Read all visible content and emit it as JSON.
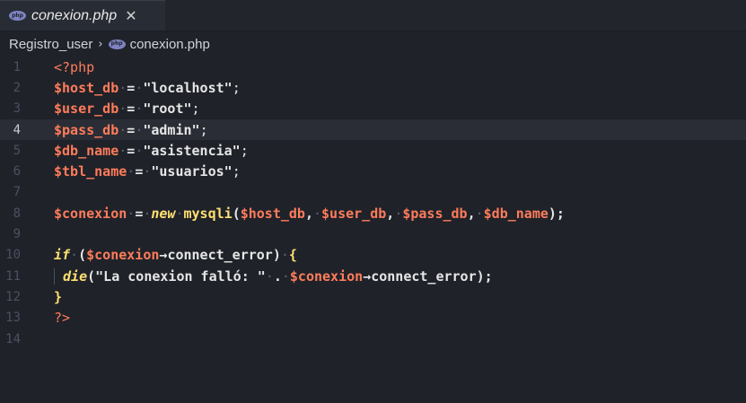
{
  "tab": {
    "icon": "php-icon",
    "icon_label": "php",
    "title": "conexion.php",
    "close_glyph": "✕"
  },
  "breadcrumb": {
    "folder": "Registro_user",
    "separator": "›",
    "file": "conexion.php"
  },
  "active_line": 4,
  "colors": {
    "background": "#1f2229",
    "variable": "#ff7c5b",
    "keyword": "#ffe071",
    "text": "#e6e6e6",
    "line_number": "#4b5161"
  },
  "lines": [
    {
      "n": "1",
      "open_tag": "<?php"
    },
    {
      "n": "2",
      "var": "$host_db",
      "eq": "=",
      "val": "\"localhost\"",
      "end": ";"
    },
    {
      "n": "3",
      "var": "$user_db",
      "eq": "=",
      "val": "\"root\"",
      "end": ";"
    },
    {
      "n": "4",
      "var": "$pass_db",
      "eq": "=",
      "val": "\"admin\"",
      "end": ";"
    },
    {
      "n": "5",
      "var": "$db_name",
      "eq": "=",
      "val": "\"asistencia\"",
      "end": ";"
    },
    {
      "n": "6",
      "var": "$tbl_name",
      "eq": "=",
      "val": "\"usuarios\"",
      "end": ";"
    },
    {
      "n": "7"
    },
    {
      "n": "8",
      "var": "$conexion",
      "eq": "=",
      "kw": "new",
      "fn": "mysqli",
      "open": "(",
      "a1": "$host_db",
      "a2": "$user_db",
      "a3": "$pass_db",
      "a4": "$db_name",
      "close": ");",
      "comma": ","
    },
    {
      "n": "9"
    },
    {
      "n": "10",
      "kw": "if",
      "open": "(",
      "var": "$conexion",
      "arrow": "→",
      "prop": "connect_error",
      "close": ")",
      "brace": "{"
    },
    {
      "n": "11",
      "fn": "die",
      "open": "(",
      "str": "\"La conexion falló: \"",
      "dot": ".",
      "var": "$conexion",
      "arrow": "→",
      "prop": "connect_error",
      "close": ");"
    },
    {
      "n": "12",
      "brace": "}"
    },
    {
      "n": "13",
      "close_tag": "?>"
    },
    {
      "n": "14"
    }
  ]
}
